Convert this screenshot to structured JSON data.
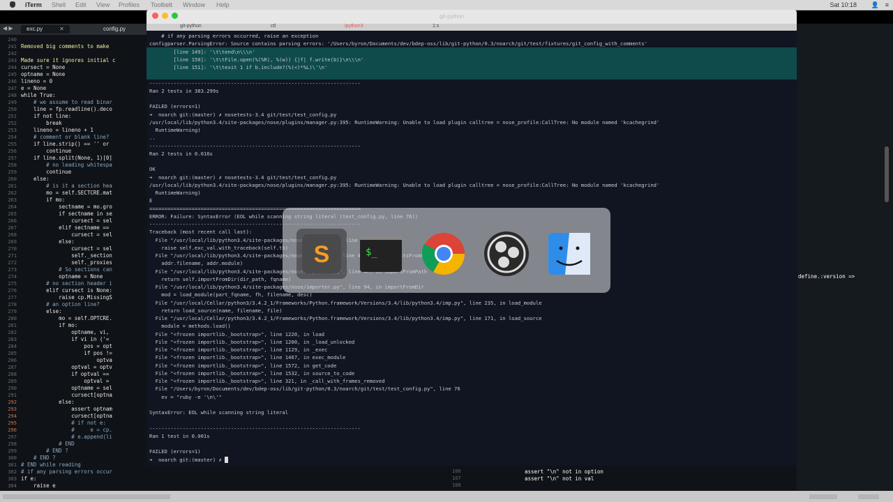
{
  "menubar": {
    "items": [
      "iTerm",
      "Shell",
      "Edit",
      "View",
      "Profiles",
      "Toolbelt",
      "Window",
      "Help"
    ],
    "clock": "Sat 10:18"
  },
  "editor": {
    "tabs": [
      {
        "label": "exc.py",
        "active": true
      },
      {
        "label": "config.py",
        "active": false
      }
    ],
    "nav_arrows": "◀ ▶",
    "line_numbers": [
      "240",
      "241",
      "242",
      "243",
      "244",
      "245",
      "246",
      "247",
      "248",
      "249",
      "250",
      "251",
      "252",
      "253",
      "254",
      "255",
      "256",
      "257",
      "258",
      "259",
      "260",
      "261",
      "262",
      "263",
      "264",
      "265",
      "266",
      "267",
      "268",
      "269",
      "270",
      "271",
      "272",
      "273",
      "274",
      "275",
      "276",
      "277",
      "278",
      "279",
      "280",
      "281",
      "282",
      "283",
      "284",
      "285",
      "286",
      "287",
      "288",
      "289",
      "290",
      "291",
      "292",
      "293",
      "294",
      "295",
      "296",
      "297",
      "298",
      "299",
      "300",
      "301",
      "302",
      "303",
      "304"
    ],
    "code_lines": [
      "",
      "Removed big comments to make",
      "",
      "Made sure it ignores initial c",
      "cursect = None",
      "optname = None",
      "lineno = 0",
      "e = None",
      "while True:",
      "    # we assume to read binar",
      "    line = fp.readline().deco",
      "    if not line:",
      "        break",
      "    lineno = lineno + 1",
      "    # comment or blank line?",
      "    if line.strip() == '' or",
      "        continue",
      "    if line.split(None, 1)[0]",
      "        # no leading whitespa",
      "        continue",
      "    else:",
      "        # is it a section hea",
      "        mo = self.SECTCRE.mat",
      "        if mo:",
      "            sectname = mo.gro",
      "            if sectname in se",
      "                cursect = sel",
      "            elif sectname ==",
      "                cursect = sel",
      "            else:",
      "                cursect = sel",
      "                self._section",
      "                self._proxies",
      "            # So sections can",
      "            optname = None",
      "        # no section header i",
      "        elif cursect is None:",
      "            raise cp.MissingS",
      "        # an option line?",
      "        else:",
      "            mo = self.OPTCRE.",
      "            if mo:",
      "                optname, vi, ",
      "                if vi in ('=",
      "                    pos = opt",
      "                    if pos !=",
      "                        optva",
      "                optval = optv",
      "                if optval ==",
      "                    optval =",
      "                optname = sel",
      "                cursect[optna",
      "            else:",
      "                assert optnam",
      "                cursect[optna",
      "                # if not e:",
      "                #     e = cp.",
      "                # e.append(li",
      "            # END",
      "        # END ?",
      "    # END ?",
      "# END while reading",
      "# if any parsing errors occur",
      "if e:",
      "    raise e"
    ],
    "marked_lines": [
      "292",
      "293",
      "294",
      "295",
      "296"
    ]
  },
  "terminal": {
    "window_title": "git-python",
    "tabs": [
      "git-python",
      "ctl",
      "ipython3",
      "1:s"
    ],
    "lines": [
      "    # if any parsing errors occurred, raise an exception",
      "configparser.ParsingError: Source contains parsing errors: '/Users/byron/Documents/dev/bdep-oss/lib/git-python/0.3/noarch/git/test/fixtures/git_config_with_comments'",
      "        [line 149]: '\\t\\tend\\n\\\\\\n'",
      "        [line 150]: '\\t\\tFile.open(%(%R), %(w)) {|f| f.write(b)}\\n\\\\\\n'",
      "        [line 151]: '\\t\\texit 1 if b.include?(%(<)*%L)\\'\\n'",
      "",
      "----------------------------------------------------------------------",
      "Ran 2 tests in 383.299s",
      "",
      "FAILED (errors=1)",
      "➜  noarch git:(master) ✗ nosetests-3.4 git/test/test_config.py",
      "/usr/local/lib/python3.4/site-packages/nose/plugins/manager.py:395: RuntimeWarning: Unable to load plugin calltree = nose_profile:CallTree: No module named 'kcachegrind'",
      "  RuntimeWarning)",
      "..",
      "----------------------------------------------------------------------",
      "Ran 2 tests in 0.016s",
      "",
      "OK",
      "➜  noarch git:(master) ✗ nosetests-3.4 git/test/test_config.py",
      "/usr/local/lib/python3.4/site-packages/nose/plugins/manager.py:395: RuntimeWarning: Unable to load plugin calltree = nose_profile:CallTree: No module named 'kcachegrind'",
      "  RuntimeWarning)",
      "E",
      "======================================================================",
      "ERROR: Failure: SyntaxError (EOL while scanning string literal (test_config.py, line 76))",
      "----------------------------------------------------------------------",
      "Traceback (most recent call last):",
      "  File \"/usr/local/lib/python3.4/site-packages/nose/failure.py\", line 39, in runTest",
      "    raise self.exc_val.with_traceback(self.tb)",
      "  File \"/usr/local/lib/python3.4/site-packages/nose/loader.py\", line 418, in loadTestsFromName",
      "    addr.filename, addr.module)",
      "  File \"/usr/local/lib/python3.4/site-packages/nose/importer.py\", line 47, in importFromPath",
      "    return self.importFromDir(dir_path, fqname)",
      "  File \"/usr/local/lib/python3.4/site-packages/nose/importer.py\", line 94, in importFromDir",
      "    mod = load_module(part_fqname, fh, filename, desc)",
      "  File \"/usr/local/Cellar/python3/3.4.2_1/Frameworks/Python.framework/Versions/3.4/lib/python3.4/imp.py\", line 235, in load_module",
      "    return load_source(name, filename, file)",
      "  File \"/usr/local/Cellar/python3/3.4.2_1/Frameworks/Python.framework/Versions/3.4/lib/python3.4/imp.py\", line 171, in load_source",
      "    module = methods.load()",
      "  File \"<frozen importlib._bootstrap>\", line 1220, in load",
      "  File \"<frozen importlib._bootstrap>\", line 1200, in _load_unlocked",
      "  File \"<frozen importlib._bootstrap>\", line 1129, in _exec",
      "  File \"<frozen importlib._bootstrap>\", line 1467, in exec_module",
      "  File \"<frozen importlib._bootstrap>\", line 1572, in get_code",
      "  File \"<frozen importlib._bootstrap>\", line 1532, in source_to_code",
      "  File \"<frozen importlib._bootstrap>\", line 321, in _call_with_frames_removed",
      "  File \"/Users/byron/Documents/dev/bdep-oss/lib/git-python/0.3/noarch/git/test/test_config.py\", line 76",
      "    ev = \"ruby -e '\\n\\'\"",
      "",
      "SyntaxError: EOL while scanning string literal",
      "",
      "----------------------------------------------------------------------",
      "Ran 1 test in 0.001s",
      "",
      "FAILED (errors=1)",
      "➜  noarch git:(master) ✗ "
    ]
  },
  "app_switcher": {
    "apps": [
      {
        "name": "Sublime Text",
        "icon": "sublime-icon",
        "selected": true
      },
      {
        "name": "iTerm",
        "icon": "terminal-icon",
        "selected": false
      },
      {
        "name": "Chrome",
        "icon": "chrome-icon",
        "selected": false
      },
      {
        "name": "OBS",
        "icon": "obs-icon",
        "selected": false
      },
      {
        "name": "Finder",
        "icon": "finder-icon",
        "selected": false
      }
    ]
  },
  "right_pane": {
    "text": "define.:version =>"
  },
  "bottom_pane": {
    "line_numbers": [
      "106",
      "107",
      "108"
    ],
    "code": [
      "assert \"\\n\" not in option",
      "assert \"\\n\" not in val"
    ]
  },
  "colors": {
    "terminal_bg": "#101521",
    "highlight_band": "#0f4b4b",
    "prompt_arrow": "#e85a5a",
    "editor_bg": "#0f1217"
  }
}
